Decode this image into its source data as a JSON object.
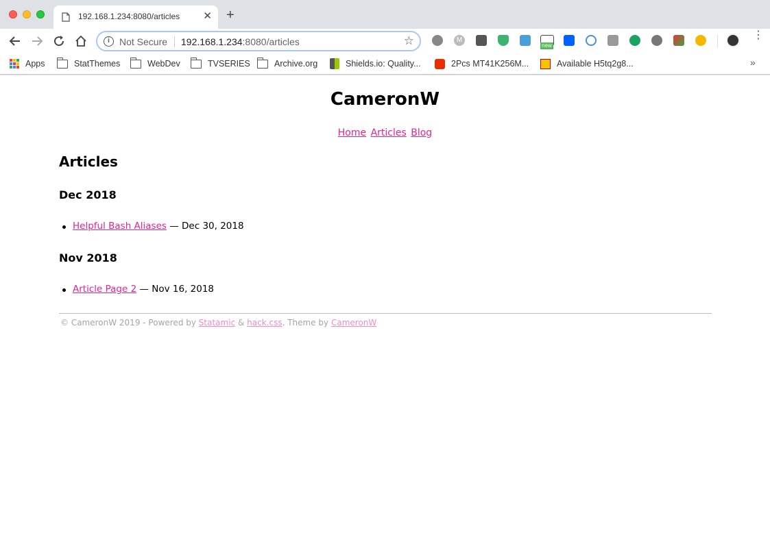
{
  "browser": {
    "tab_title": "192.168.1.234:8080/articles",
    "security_label": "Not Secure",
    "url_host": "192.168.1.234",
    "url_path": ":8080/articles",
    "ext_badge_new": "new",
    "bookmarks": [
      {
        "label": "Apps",
        "icon": "apps-grid-icon"
      },
      {
        "label": "StatThemes",
        "icon": "folder-icon"
      },
      {
        "label": "WebDev",
        "icon": "folder-icon"
      },
      {
        "label": "TVSERIES",
        "icon": "folder-icon"
      },
      {
        "label": "Archive.org",
        "icon": "folder-icon"
      },
      {
        "label": "Shields.io: Quality...",
        "icon": "shields-icon"
      },
      {
        "label": "2Pcs MT41K256M...",
        "icon": "aliexpress-icon"
      },
      {
        "label": "Available H5tq2g8...",
        "icon": "ebay-icon"
      }
    ],
    "accent_color": "#a8c7fa"
  },
  "site": {
    "title": "CameronW",
    "nav": [
      "Home",
      "Articles",
      "Blog"
    ],
    "link_color": "#e3238f",
    "heading": "Articles",
    "groups": [
      {
        "month": "Dec 2018",
        "entries": [
          {
            "title": "Helpful Bash Aliases",
            "date": "— Dec 30, 2018"
          }
        ]
      },
      {
        "month": "Nov 2018",
        "entries": [
          {
            "title": "Article Page 2",
            "date": "— Nov 16, 2018"
          }
        ]
      }
    ],
    "footer": {
      "prefix": "© CameronW 2019 - Powered by",
      "link1": "Statamic",
      "amp": "&",
      "link2": "hack.css",
      "middle": ". Theme by",
      "link3": "CameronW"
    }
  }
}
